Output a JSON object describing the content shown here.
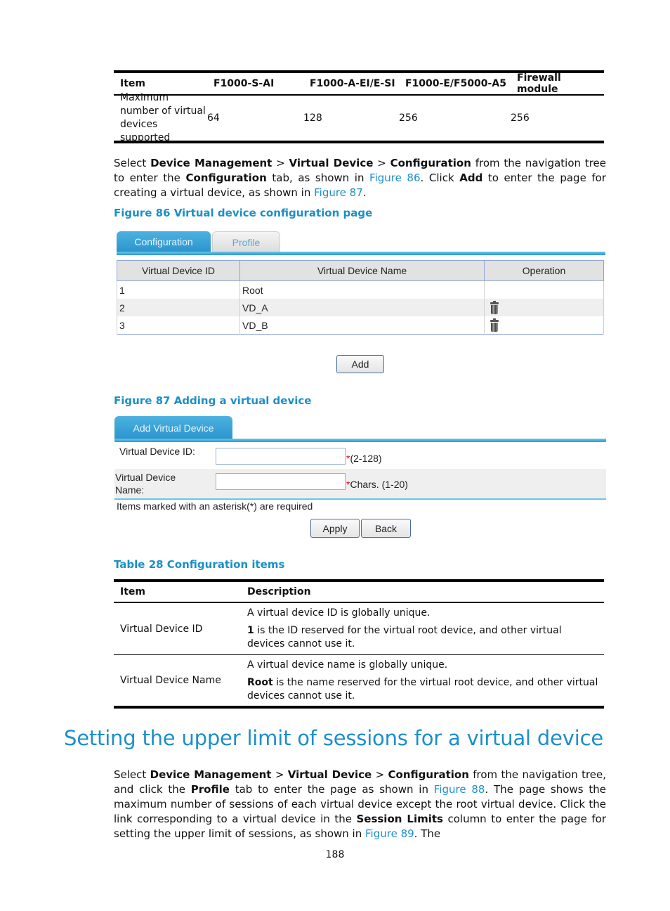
{
  "spec_table": {
    "headers": [
      "Item",
      "F1000-S-AI",
      "F1000-A-EI/E-SI",
      "F1000-E/F5000-A5",
      "Firewall module"
    ],
    "rows": [
      [
        "Maximum number of virtual devices supported",
        "64",
        "128",
        "256",
        "256"
      ]
    ]
  },
  "para1": {
    "t1": "Select ",
    "b1": "Device Management",
    "t2": " > ",
    "b2": "Virtual Device",
    "t3": " > ",
    "b3": "Configuration",
    "t4": " from the navigation tree to enter the ",
    "b4": "Configuration",
    "t5": " tab, as shown in ",
    "link1": "Figure 86",
    "t6": ". Click ",
    "b5": "Add",
    "t7": " to enter the page for creating a virtual device, as shown in ",
    "link2": "Figure 87",
    "t8": "."
  },
  "figure86": {
    "caption": "Figure 86 Virtual device configuration page",
    "tabs": [
      "Configuration",
      "Profile"
    ],
    "active_tab": "Configuration",
    "table_headers": [
      "Virtual Device ID",
      "Virtual Device Name",
      "Operation"
    ],
    "rows": [
      {
        "id": "1",
        "name": "Root",
        "delete": false
      },
      {
        "id": "2",
        "name": "VD_A",
        "delete": true
      },
      {
        "id": "3",
        "name": "VD_B",
        "delete": true
      }
    ],
    "add_button": "Add"
  },
  "figure87": {
    "caption": "Figure 87 Adding a virtual device",
    "tab": "Add Virtual Device",
    "fields": [
      {
        "label": "Virtual Device ID:",
        "value": "",
        "asterisk": "*",
        "hint": "(2-128)"
      },
      {
        "label": "Virtual Device Name:",
        "value": "",
        "asterisk": "*",
        "hint": "Chars. (1-20)"
      }
    ],
    "required_note": "Items marked with an asterisk(*) are required",
    "apply_button": "Apply",
    "back_button": "Back"
  },
  "table28": {
    "caption": "Table 28 Configuration items",
    "headers": [
      "Item",
      "Description"
    ],
    "rows": [
      {
        "item": "Virtual Device ID",
        "desc1": "A virtual device ID is globally unique.",
        "desc2_bold": "1",
        "desc2_rest": " is the ID reserved for the virtual root device, and other virtual devices cannot use it."
      },
      {
        "item": "Virtual Device Name",
        "desc1": "A virtual device name is globally unique.",
        "desc2_bold": "Root",
        "desc2_rest": " is the name reserved for the virtual root device, and other virtual devices cannot use it."
      }
    ]
  },
  "section": {
    "heading": "Setting the upper limit of sessions for a virtual device"
  },
  "para2": {
    "t1": "Select ",
    "b1": "Device Management",
    "t2": " > ",
    "b2": "Virtual Device",
    "t3": " > ",
    "b3": "Configuration",
    "t4": " from the navigation tree, and click the ",
    "b4": "Profile",
    "t5": " tab to enter the page as shown in ",
    "link1": "Figure 88",
    "t6": ". The page shows the maximum number of sessions of each virtual device except the root virtual device. Click the link corresponding to a virtual device in the ",
    "b5": "Session Limits",
    "t7": " column to enter the page for setting the upper limit of sessions, as shown in ",
    "link2": "Figure 89",
    "t8": ". The"
  },
  "page_number": "188"
}
